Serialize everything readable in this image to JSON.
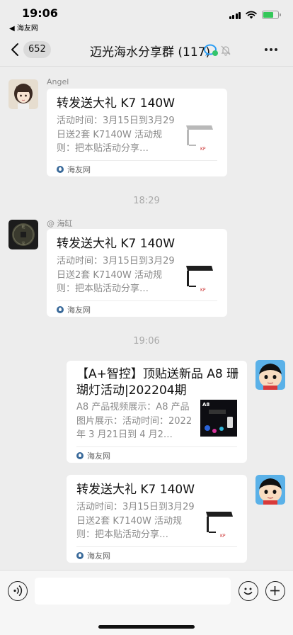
{
  "status_bar": {
    "time": "19:06",
    "back_app": "◀ 海友网",
    "battery_level": 0.7
  },
  "header": {
    "back_count": "652",
    "title": "迈光海水分享群 (117)"
  },
  "messages": [
    {
      "sender": "Angel",
      "title": "转发送大礼  K7 140W",
      "desc": "活动时间：3月15日到3月29日送2套 K7140W 活动规则：把本贴活动分享…",
      "source": "海友网"
    },
    {
      "timestamp": "18:29"
    },
    {
      "sender": "@ 海缸",
      "title": "转发送大礼  K7 140W",
      "desc": "活动时间：3月15日到3月29日送2套 K7140W 活动规则：把本贴活动分享…",
      "source": "海友网"
    },
    {
      "timestamp": "19:06"
    },
    {
      "title_line1": "【A+智控】顶贴送新品 A8 珊",
      "title_line2": "瑚灯活动|202204期",
      "desc": "A8 产品视频展示：A8 产品图片展示：活动时间：2022 年 3 月21日到 4 月2…",
      "source": "海友网"
    },
    {
      "title": "转发送大礼  K7 140W",
      "desc": "活动时间：3月15日到3月29日送2套 K7140W 活动规则：把本贴活动分享…",
      "source": "海友网"
    }
  ],
  "colors": {
    "background": "#ededed",
    "bubble": "#ffffff",
    "timestamp": "#aaaaaa",
    "battery": "#34c759"
  },
  "icons": {
    "voice": "voice-icon",
    "emoji": "emoji-icon",
    "plus": "plus-icon",
    "more": "more-icon",
    "mute": "mute-bell-icon"
  }
}
